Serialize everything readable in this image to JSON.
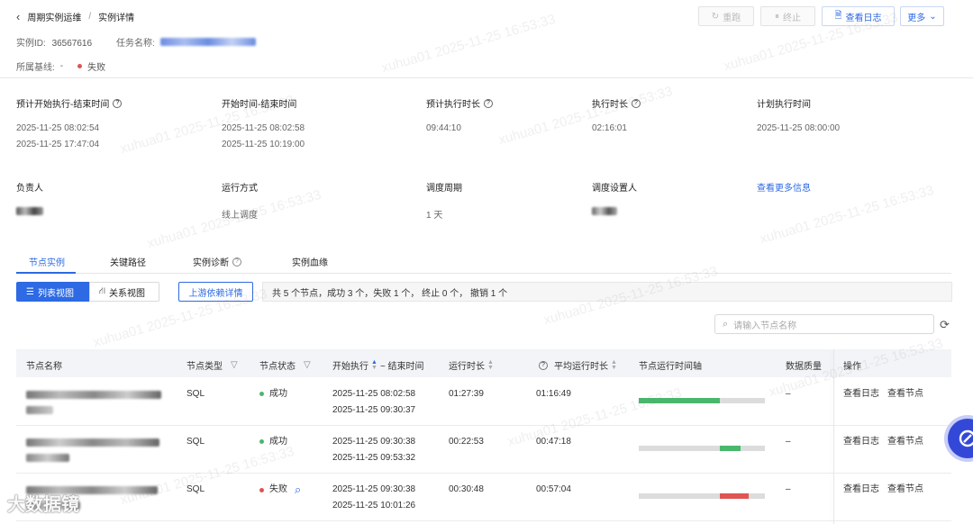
{
  "breadcrumb": {
    "parent": "周期实例运维",
    "separator": "/",
    "current": "实例详情"
  },
  "instance": {
    "id_label": "实例ID:",
    "id_value": "36567616",
    "task_label": "任务名称:",
    "baseline_label": "所属基线:",
    "baseline_value": "-",
    "status": "失败"
  },
  "toolbar": {
    "rerun": "重跑",
    "stop": "终止",
    "view_log": "查看日志",
    "more": "更多"
  },
  "info": {
    "planned_start_end_label": "预计开始执行-结束时间",
    "planned_start": "2025-11-25 08:02:54",
    "planned_end": "2025-11-25 17:47:04",
    "start_end_label": "开始时间-结束时间",
    "start": "2025-11-25 08:02:58",
    "end": "2025-11-25 10:19:00",
    "est_duration_label": "预计执行时长",
    "est_duration": "09:44:10",
    "duration_label": "执行时长",
    "duration": "02:16:01",
    "planned_time_label": "计划执行时间",
    "planned_time": "2025-11-25 08:00:00",
    "owner_label": "负责人",
    "run_mode_label": "运行方式",
    "run_mode": "线上调度",
    "schedule_cycle_label": "调度周期",
    "schedule_cycle": "1 天",
    "scheduler_label": "调度设置人",
    "more_info": "查看更多信息"
  },
  "tabs": [
    "节点实例",
    "关键路径",
    "实例诊断",
    "实例血缘"
  ],
  "views": {
    "list": "列表视图",
    "relation": "关系视图",
    "upstream": "上游依赖详情"
  },
  "summary": "共 5 个节点，成功 3 个，失败 1 个，  终止 0 个，   撤销 1 个",
  "search": {
    "placeholder": "请输入节点名称"
  },
  "columns": [
    "节点名称",
    "节点类型",
    "节点状态",
    "开始执行",
    "~ 结束时间",
    "运行时长",
    "平均运行时长",
    "节点运行时间轴",
    "数据质量",
    "操作"
  ],
  "rows": [
    {
      "type": "SQL",
      "status": "成功",
      "start": "2025-11-25 08:02:58",
      "end": "2025-11-25 09:30:37",
      "duration": "01:27:39",
      "avg": "01:16:49",
      "quality": "–",
      "op1": "查看日志",
      "op2": "查看节点"
    },
    {
      "type": "SQL",
      "status": "成功",
      "start": "2025-11-25 09:30:38",
      "end": "2025-11-25 09:53:32",
      "duration": "00:22:53",
      "avg": "00:47:18",
      "quality": "–",
      "op1": "查看日志",
      "op2": "查看节点"
    },
    {
      "type": "SQL",
      "status": "失败",
      "start": "2025-11-25 09:30:38",
      "end": "2025-11-25 10:01:26",
      "duration": "00:30:48",
      "avg": "00:57:04",
      "quality": "–",
      "op1": "查看日志",
      "op2": "查看节点"
    }
  ],
  "timeline_fractions": [
    {
      "from": 0.0,
      "to": 0.64
    },
    {
      "from": 0.64,
      "to": 0.81
    },
    {
      "from": 0.64,
      "to": 0.87
    }
  ],
  "colors": {
    "accent": "#2d6ae3",
    "success": "#49b86d",
    "fail": "#e05454"
  },
  "watermark": "xuhua01 2025-11-25 16:53:33",
  "brand": "大数据镜"
}
